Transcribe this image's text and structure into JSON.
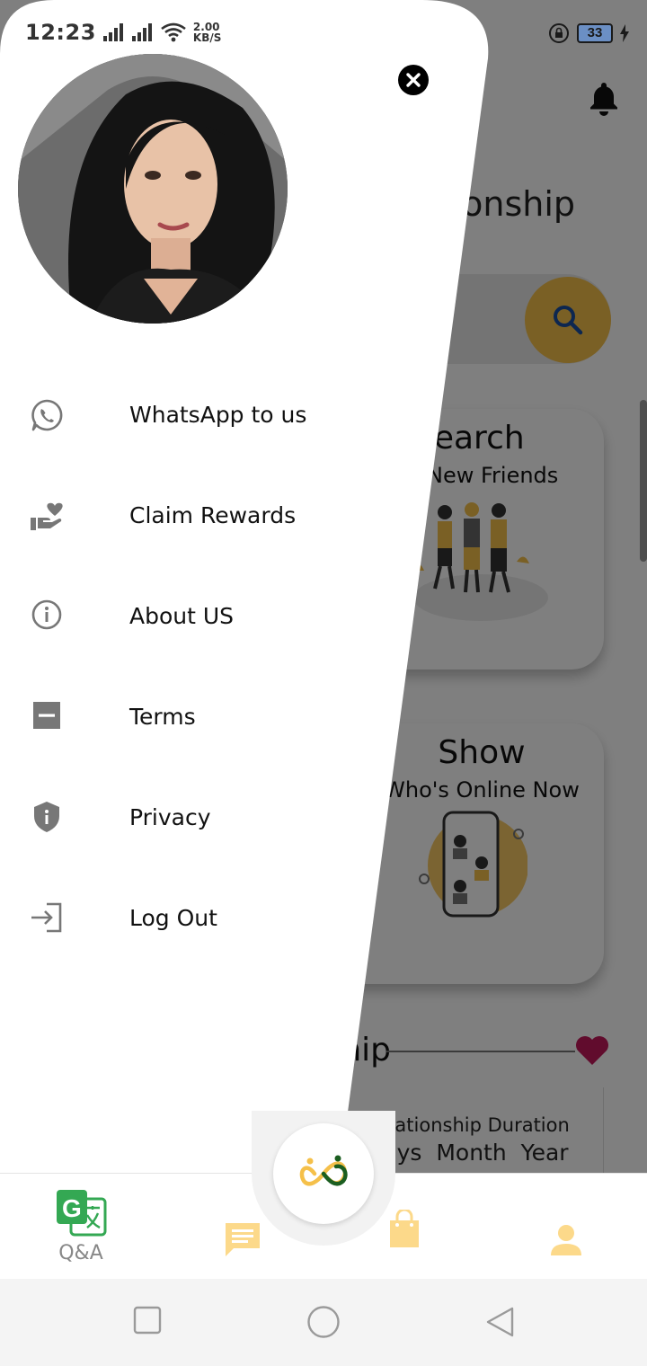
{
  "status_bar": {
    "time": "12:23",
    "speed_value": "2.00",
    "speed_unit": "KB/S",
    "battery": "33"
  },
  "background": {
    "title_fragment": "ionship",
    "card1": {
      "title": "Search",
      "subtitle": "New Friends"
    },
    "card2": {
      "title": "Show",
      "subtitle": "Who's Online Now"
    },
    "relationship_header_fragment": "ship",
    "relationship_duration_label": "Relationship Duration",
    "relationship_units": "Days  Month  Year"
  },
  "drawer": {
    "menu": [
      {
        "label": "WhatsApp to us",
        "icon": "whatsapp-icon"
      },
      {
        "label": "Claim Rewards",
        "icon": "hand-heart-icon"
      },
      {
        "label": "About US",
        "icon": "info-icon"
      },
      {
        "label": "Terms",
        "icon": "minus-box-icon"
      },
      {
        "label": "Privacy",
        "icon": "shield-info-icon"
      },
      {
        "label": "Log Out",
        "icon": "logout-icon"
      }
    ]
  },
  "bottom_nav": {
    "qa_label": "Q&A",
    "items": [
      "translate-icon",
      "chat-icon",
      "logo-icon",
      "shopping-bag-icon",
      "person-icon"
    ]
  },
  "colors": {
    "accent_yellow": "#f5c04a",
    "nav_yellow": "#fcd98a",
    "google_green": "#34a853",
    "heart_red": "#c2185b"
  }
}
